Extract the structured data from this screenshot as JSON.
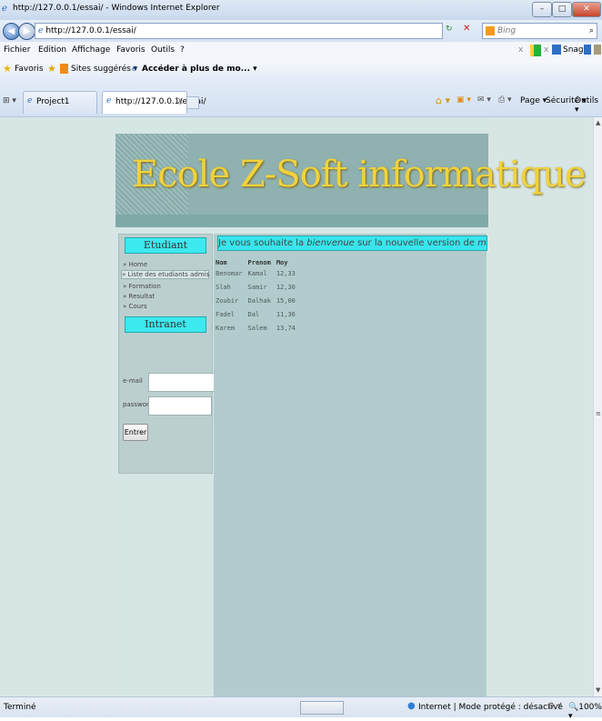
{
  "window": {
    "title": "http://127.0.0.1/essai/ - Windows Internet Explorer"
  },
  "address_bar": {
    "url": "http://127.0.0.1/essai/",
    "search_placeholder": "Bing"
  },
  "menu": [
    "Fichier",
    "Edition",
    "Affichage",
    "Favoris",
    "Outils",
    "?"
  ],
  "toolbar_right": {
    "snagit": "SnagIt"
  },
  "favorites_bar": {
    "favoris": "Favoris",
    "sites": "Sites suggérés ▾",
    "more": "Accéder à plus de mo... ▾"
  },
  "tabs": [
    {
      "label": "Project1"
    },
    {
      "label": "http://127.0.0.1/essai/",
      "close": "X"
    }
  ],
  "command_bar": {
    "page": "Page ▾",
    "securite": "Sécurité ▾",
    "outils": "Outils ▾"
  },
  "page": {
    "site_title": "Ecole Z-Soft informatique",
    "sidebar": {
      "section1": "Etudiant",
      "links": [
        "Home",
        "Liste des etudiants admis",
        "Formation",
        "Resultat",
        "Cours"
      ],
      "section2": "Intranet",
      "email_label": "e-mail",
      "password_label": "password:",
      "enter_button": "Entrer"
    },
    "welcome": {
      "part1": "Je vous souhaite la ",
      "part2": "bienvenue",
      "part3": " sur la nouvelle version de ",
      "part4": "mon site web"
    },
    "table": {
      "headers": [
        "Nom",
        "Prenom",
        "Moy"
      ],
      "rows": [
        [
          "Benomar",
          "Kamal",
          "12,33"
        ],
        [
          "Slah",
          "Samir",
          "12,30"
        ],
        [
          "Zoubir",
          "Dalhak",
          "15,00"
        ],
        [
          "Fadel",
          "Dal",
          "11,36"
        ],
        [
          "Karem",
          "Salem",
          "13,74"
        ]
      ]
    }
  },
  "status_bar": {
    "left": "Terminé",
    "zone": "Internet | Mode protégé : désactivé",
    "zoom": "100%"
  }
}
